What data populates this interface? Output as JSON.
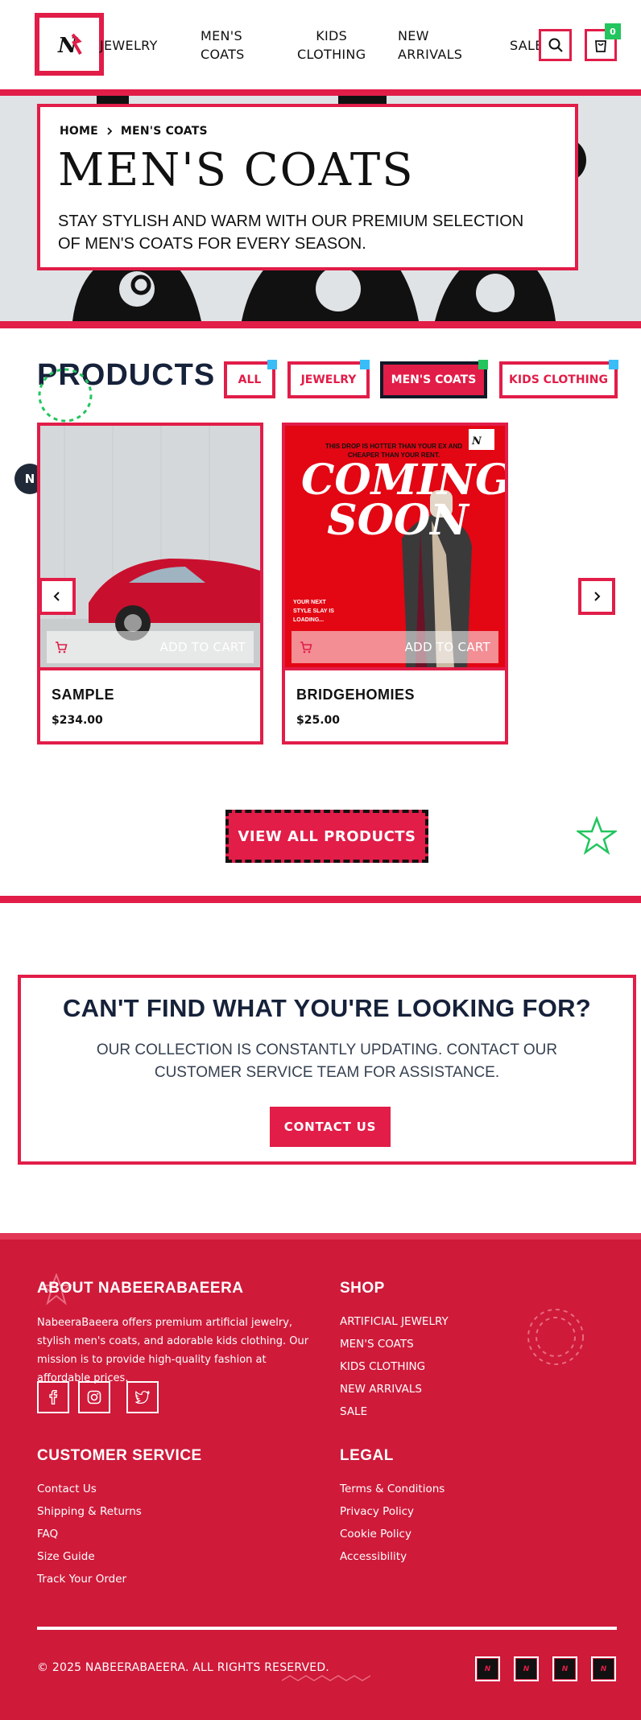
{
  "header": {
    "logo_text": "N",
    "nav": [
      "JEWELRY",
      "MEN'S COATS",
      "KIDS CLOTHING",
      "NEW ARRIVALS",
      "SALE"
    ],
    "nav_lines": {
      "mens_coats": [
        "MEN'S",
        "COATS"
      ],
      "kids_clothing": [
        "KIDS",
        "CLOTHING"
      ],
      "new_arrivals": [
        "NEW",
        "ARRIVALS"
      ]
    },
    "cart_count": "0",
    "icons": {
      "search": "search-icon",
      "cart": "shopping-bag-icon"
    }
  },
  "hero": {
    "breadcrumb": {
      "home": "HOME",
      "current": "MEN'S COATS"
    },
    "title": "MEN'S COATS",
    "subtitle": "STAY STYLISH AND WARM WITH OUR PREMIUM SELECTION OF MEN'S COATS FOR EVERY SEASON."
  },
  "products": {
    "title": "PRODUCTS",
    "filters": [
      "ALL",
      "JEWELRY",
      "MEN'S COATS",
      "KIDS CLOTHING"
    ],
    "active_filter": "MEN'S COATS",
    "add_to_cart_label": "ADD TO CART",
    "items": [
      {
        "name": "SAMPLE",
        "price": "$234.00",
        "image": "red-sports-car"
      },
      {
        "name": "BRIDGEHOMIES",
        "price": "$25.00",
        "image": "coming-soon-poster",
        "poster": {
          "tagline": "THIS DROP IS HOTTER THAN YOUR EX AND CHEAPER THAN YOUR RENT.",
          "headline_1": "COMING",
          "headline_2": "SOON",
          "footnote": "YOUR NEXT STYLE SLAY IS LOADING..."
        }
      }
    ],
    "view_all_label": "VIEW ALL PRODUCTS",
    "floating_badge": "N"
  },
  "cta": {
    "title": "CAN'T FIND WHAT YOU'RE LOOKING FOR?",
    "text": "OUR COLLECTION IS CONSTANTLY UPDATING. CONTACT OUR CUSTOMER SERVICE TEAM FOR ASSISTANCE.",
    "button": "CONTACT US"
  },
  "footer": {
    "about": {
      "heading": "ABOUT NABEERABAEERA",
      "text": "NabeeraBaeera offers premium artificial jewelry, stylish men's coats, and adorable kids clothing. Our mission is to provide high-quality fashion at affordable prices."
    },
    "shop": {
      "heading": "SHOP",
      "links": [
        "ARTIFICIAL JEWELRY",
        "MEN'S COATS",
        "KIDS CLOTHING",
        "NEW ARRIVALS",
        "SALE"
      ]
    },
    "customer_service": {
      "heading": "CUSTOMER SERVICE",
      "links": [
        "Contact Us",
        "Shipping & Returns",
        "FAQ",
        "Size Guide",
        "Track Your Order"
      ]
    },
    "legal": {
      "heading": "LEGAL",
      "links": [
        "Terms & Conditions",
        "Privacy Policy",
        "Cookie Policy",
        "Accessibility"
      ]
    },
    "social": [
      "facebook-icon",
      "instagram-icon",
      "twitter-icon"
    ],
    "copyright": "© 2025 NABEERABAEERA. ALL RIGHTS RESERVED.",
    "payment_badge_text": "N"
  },
  "colors": {
    "accent": "#e11d48",
    "footer_bg": "#cf1a3a",
    "heading_dark": "#16213a",
    "active_indicator": "#22c55e"
  }
}
